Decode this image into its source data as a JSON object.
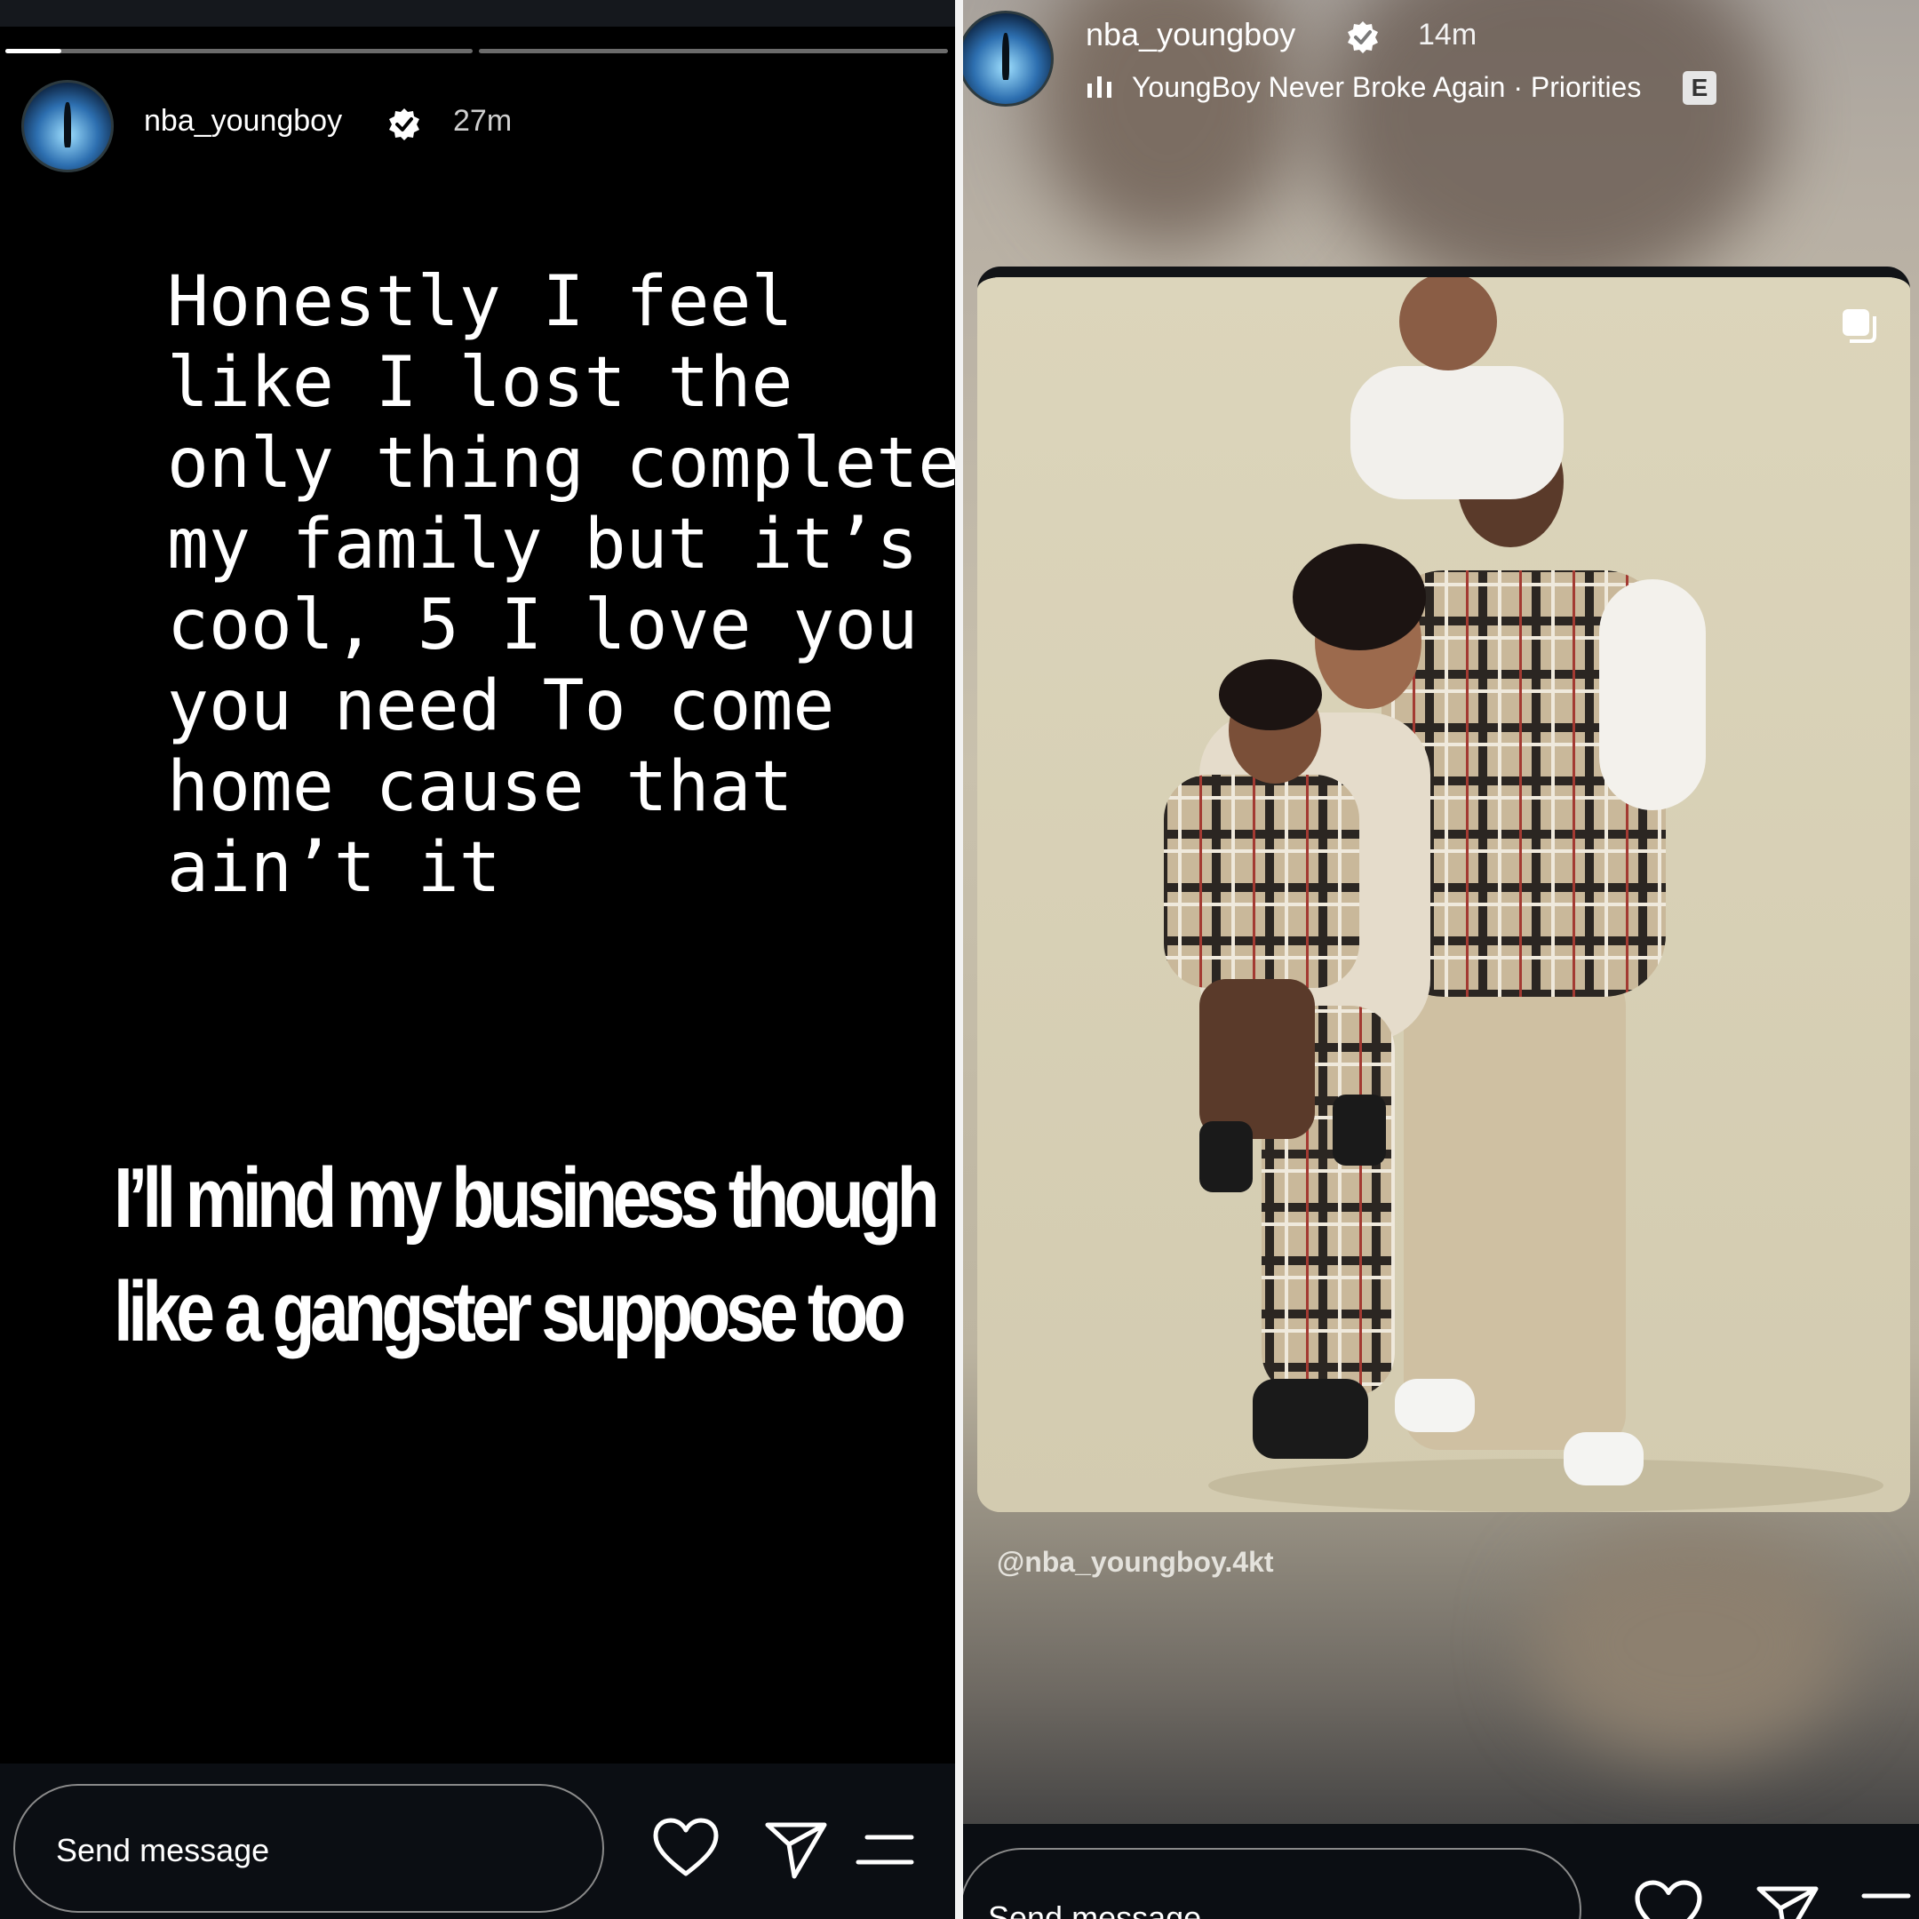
{
  "left_story": {
    "progress_fill": 0.12,
    "username": "nba_youngboy",
    "time_ago": "27m",
    "story_text": [
      "Honestly I feel",
      "like I lost the",
      "only thing complete",
      "my family but it’s",
      "cool, 5 I love you",
      "you need To come",
      "home cause that",
      "ain’t it"
    ],
    "caption_lines": [
      "I’ll mind my business though",
      "like a gangster suppose too"
    ],
    "message_placeholder": "Send message"
  },
  "right_story": {
    "username": "nba_youngboy",
    "time_ago": "14m",
    "music": {
      "song": "YoungBoy Never Broke Again",
      "separator": " · ",
      "track": "Priorities",
      "explicit_badge": "E"
    },
    "watermark": "@nba_youngboy.4kt",
    "message_placeholder": "Send message"
  },
  "icons": {
    "verified": "verified-badge-icon",
    "like": "heart-icon",
    "share": "paper-plane-icon",
    "more": "menu-lines-icon",
    "copy": "copy-icon",
    "music": "music-bars-icon"
  },
  "colors": {
    "story_bg": "#000000",
    "text": "#ffffff",
    "photo_bg": "#d9d2b6"
  }
}
